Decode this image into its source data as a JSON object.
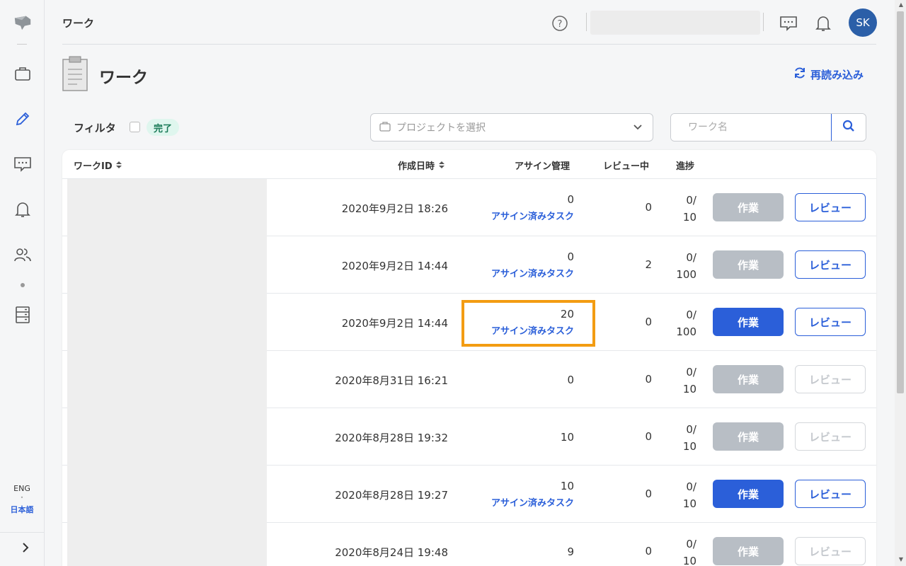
{
  "sidebar": {
    "lang_eng": "ENG",
    "lang_sep": "•",
    "lang_ja": "日本語"
  },
  "topbar": {
    "breadcrumb": "ワーク",
    "avatar_initials": "SK"
  },
  "page": {
    "title": "ワーク",
    "reload_label": "再読み込み"
  },
  "filter": {
    "label": "フィルタ",
    "completed_badge": "完了",
    "project_placeholder": "プロジェクトを選択",
    "search_placeholder": "ワーク名"
  },
  "table": {
    "headers": {
      "id": "ワークID",
      "created": "作成日時",
      "assign": "アサイン管理",
      "in_review": "レビュー中",
      "progress": "進捗"
    },
    "work_label": "作業",
    "review_label": "レビュー",
    "assigned_link": "アサイン済みタスク",
    "rows": [
      {
        "date": "2020年9月2日 18:26",
        "assign": "0",
        "assigned_link": true,
        "in_review": "0",
        "progress_done": "0/",
        "progress_total": "10",
        "work_enabled": false,
        "review_enabled": true
      },
      {
        "date": "2020年9月2日 14:44",
        "assign": "0",
        "assigned_link": true,
        "in_review": "2",
        "progress_done": "0/",
        "progress_total": "100",
        "work_enabled": false,
        "review_enabled": true
      },
      {
        "date": "2020年9月2日 14:44",
        "assign": "20",
        "assigned_link": true,
        "in_review": "0",
        "progress_done": "0/",
        "progress_total": "100",
        "work_enabled": true,
        "review_enabled": true
      },
      {
        "date": "2020年8月31日 16:21",
        "assign": "0",
        "assigned_link": false,
        "in_review": "0",
        "progress_done": "0/",
        "progress_total": "10",
        "work_enabled": false,
        "review_enabled": false
      },
      {
        "date": "2020年8月28日 19:32",
        "assign": "10",
        "assigned_link": false,
        "in_review": "0",
        "progress_done": "0/",
        "progress_total": "10",
        "work_enabled": false,
        "review_enabled": false
      },
      {
        "date": "2020年8月28日 19:27",
        "assign": "10",
        "assigned_link": true,
        "in_review": "0",
        "progress_done": "0/",
        "progress_total": "10",
        "work_enabled": true,
        "review_enabled": true
      },
      {
        "date": "2020年8月24日 19:48",
        "assign": "9",
        "assigned_link": false,
        "in_review": "0",
        "progress_done": "0/",
        "progress_total": "10",
        "work_enabled": false,
        "review_enabled": false
      }
    ]
  },
  "colors": {
    "accent": "#2b5fd9",
    "disabled": "#b8bec5",
    "highlight": "#f39c12",
    "badge_bg": "#dff6ee"
  }
}
